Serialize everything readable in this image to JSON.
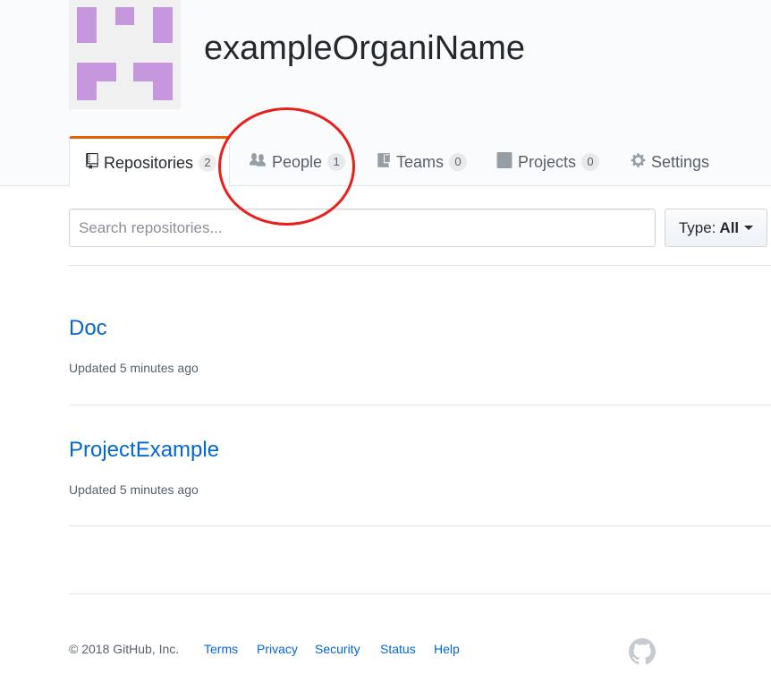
{
  "org": {
    "name": "exampleOrganiName"
  },
  "tabs": [
    {
      "label": "Repositories",
      "count": "2",
      "icon": "repo-icon",
      "selected": true
    },
    {
      "label": "People",
      "count": "1",
      "icon": "people-icon"
    },
    {
      "label": "Teams",
      "count": "0",
      "icon": "teams-icon"
    },
    {
      "label": "Projects",
      "count": "0",
      "icon": "projects-icon"
    },
    {
      "label": "Settings",
      "icon": "gear-icon"
    }
  ],
  "search": {
    "placeholder": "Search repositories..."
  },
  "type_filter": {
    "label": "Type:",
    "value": "All"
  },
  "repos": [
    {
      "name": "Doc",
      "updated": "Updated 5 minutes ago"
    },
    {
      "name": "ProjectExample",
      "updated": "Updated 5 minutes ago"
    }
  ],
  "footer": {
    "copyright": "© 2018 GitHub, Inc.",
    "links": [
      "Terms",
      "Privacy",
      "Security",
      "Status",
      "Help"
    ]
  },
  "colors": {
    "accent_tab": "#e36209",
    "link": "#0366d6",
    "avatar_fill": "#c597dd",
    "annotation": "#e8201c"
  }
}
